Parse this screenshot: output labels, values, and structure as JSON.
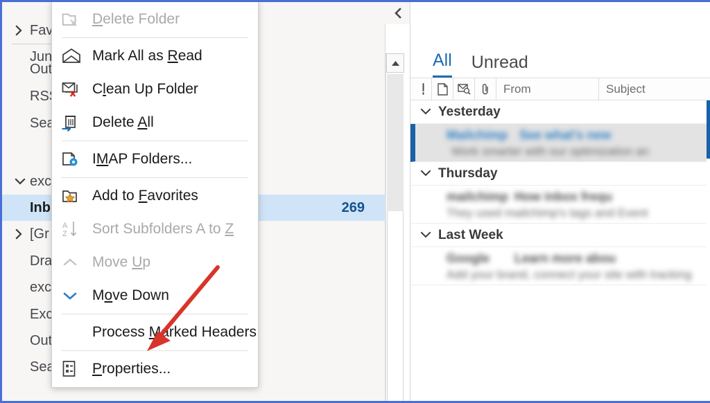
{
  "window": {
    "accent_border_color": "#4a6fd4",
    "selection_color": "#cfe4f7",
    "link_color": "#1f6bb0"
  },
  "sidebar": {
    "name": "folder-pane",
    "items": [
      {
        "label": "Fav",
        "twisty": "collapsed",
        "indent": 0,
        "selected": false,
        "count": ""
      },
      {
        "label": "Jun",
        "twisty": "none",
        "indent": 1,
        "selected": false,
        "count": ""
      },
      {
        "label": "Out",
        "twisty": "none",
        "indent": 1,
        "selected": false,
        "count": ""
      },
      {
        "label": "RSS",
        "twisty": "none",
        "indent": 1,
        "selected": false,
        "count": ""
      },
      {
        "label": "Sea",
        "twisty": "none",
        "indent": 1,
        "selected": false,
        "count": ""
      },
      {
        "label": "exc",
        "twisty": "expanded",
        "indent": 0,
        "selected": false,
        "count": ""
      },
      {
        "label": "Inb",
        "twisty": "none",
        "indent": 1,
        "selected": true,
        "count": "269"
      },
      {
        "label": "[Gr",
        "twisty": "collapsed",
        "indent": 0,
        "selected": false,
        "count": ""
      },
      {
        "label": "Dra",
        "twisty": "none",
        "indent": 1,
        "selected": false,
        "count": ""
      },
      {
        "label": "exc",
        "twisty": "none",
        "indent": 1,
        "selected": false,
        "count": ""
      },
      {
        "label": "Exc",
        "twisty": "none",
        "indent": 1,
        "selected": false,
        "count": ""
      },
      {
        "label": "Out",
        "twisty": "none",
        "indent": 1,
        "selected": false,
        "count": ""
      },
      {
        "label": "Search Folders",
        "twisty": "none",
        "indent": 1,
        "selected": false,
        "count": ""
      }
    ]
  },
  "context_menu": {
    "name": "folder-context-menu",
    "items": [
      {
        "id": "delete-folder",
        "label": "Delete Folder",
        "accel": "D",
        "icon": "folder-delete-icon",
        "disabled": true,
        "separator_after": true
      },
      {
        "id": "mark-all-as-read",
        "label": "Mark All as Read",
        "accel": "R",
        "icon": "envelope-open-icon",
        "disabled": false,
        "separator_after": false
      },
      {
        "id": "clean-up-folder",
        "label": "Clean Up Folder",
        "accel": "l",
        "icon": "envelope-clean-icon",
        "disabled": false,
        "separator_after": false
      },
      {
        "id": "delete-all",
        "label": "Delete All",
        "accel": "A",
        "icon": "trash-arrow-icon",
        "disabled": false,
        "separator_after": true
      },
      {
        "id": "imap-folders",
        "label": "IMAP Folders...",
        "accel": "M",
        "icon": "folder-gear-icon",
        "disabled": false,
        "separator_after": true
      },
      {
        "id": "add-to-favorites",
        "label": "Add to Favorites",
        "accel": "F",
        "icon": "folder-star-icon",
        "disabled": false,
        "separator_after": false
      },
      {
        "id": "sort-subfolders",
        "label": "Sort Subfolders A to Z",
        "accel": "Z",
        "icon": "sort-az-icon",
        "disabled": true,
        "separator_after": false
      },
      {
        "id": "move-up",
        "label": "Move Up",
        "accel": "U",
        "icon": "chevron-up-icon",
        "disabled": true,
        "separator_after": false
      },
      {
        "id": "move-down",
        "label": "Move Down",
        "accel": "o",
        "icon": "chevron-down-icon",
        "disabled": false,
        "separator_after": true
      },
      {
        "id": "process-marked-headers",
        "label": "Process Marked Headers",
        "accel": "M",
        "icon": "none",
        "disabled": false,
        "separator_after": true
      },
      {
        "id": "properties",
        "label": "Properties...",
        "accel": "P",
        "icon": "properties-icon",
        "disabled": false,
        "separator_after": false
      }
    ]
  },
  "message_list": {
    "name": "message-list-pane",
    "tabs": [
      {
        "label": "All",
        "active": true
      },
      {
        "label": "Unread",
        "active": false
      }
    ],
    "columns": {
      "icons": [
        "importance-icon",
        "page-icon",
        "reply-status-icon",
        "attachment-icon"
      ],
      "from_label": "From",
      "subject_label": "Subject"
    },
    "groups": [
      {
        "label": "Yesterday",
        "expanded": true,
        "messages": [
          {
            "sender": "Mailchimp",
            "subject": "See what's new",
            "preview": "Work smarter with our optimization an",
            "unread": true,
            "selected": true
          }
        ]
      },
      {
        "label": "Thursday",
        "expanded": true,
        "messages": [
          {
            "sender": "mailchimp",
            "subject": "How inbox frequ",
            "preview": "They used mailchimp's tags and Event",
            "unread": false,
            "selected": false
          }
        ]
      },
      {
        "label": "Last Week",
        "expanded": true,
        "messages": [
          {
            "sender": "Google",
            "subject": "Learn more abou",
            "preview": "Add your brand, connect your site with tracking",
            "unread": false,
            "selected": false
          }
        ]
      }
    ]
  },
  "annotation": {
    "name": "red-arrow-annotation",
    "color": "#d8342a",
    "points_to": "properties"
  }
}
